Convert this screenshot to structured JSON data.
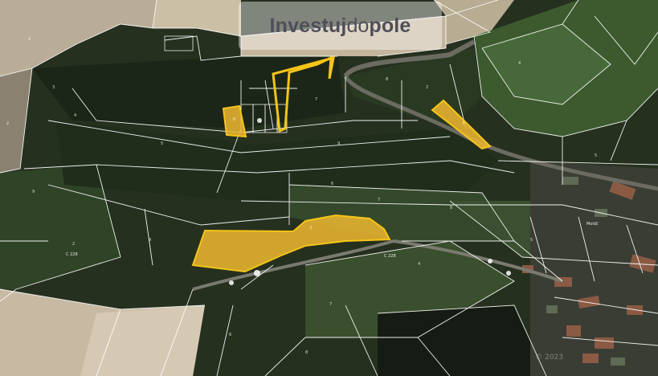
{
  "brand": {
    "part1": "Investuj",
    "part2": "do",
    "part3": "pole"
  },
  "copyright": "© 2023",
  "colors": {
    "highlight_fill": "#e8b430",
    "highlight_stroke": "#f5c518",
    "boundary_lines": "#ffffff",
    "forest": "#253222",
    "field_light": "#c9bba6",
    "field_green": "#3f5a36"
  },
  "road_labels": [
    "C 228",
    "C 228",
    "Moldč"
  ],
  "icons": [
    "lot-marker-icon"
  ]
}
